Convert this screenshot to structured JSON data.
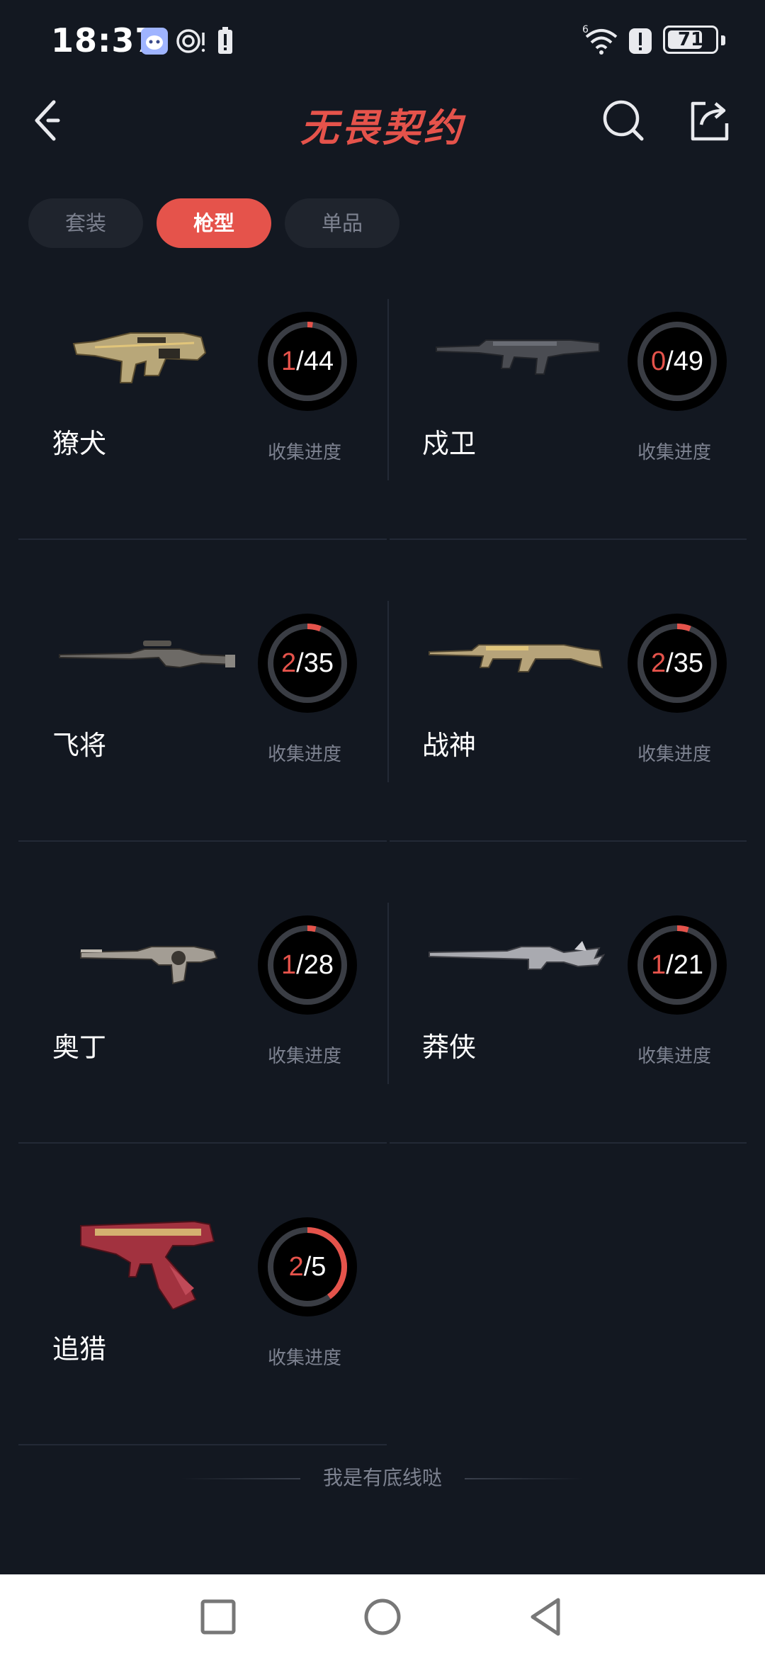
{
  "status_bar": {
    "time": "18:37",
    "battery": "71",
    "icons": [
      "app-notification-icon",
      "nfc-icon",
      "battery-alert-icon",
      "wifi-icon",
      "alert-icon"
    ]
  },
  "header": {
    "title": "无畏契约",
    "back_icon": "back-arrow-icon",
    "search_icon": "search-icon",
    "share_icon": "share-icon"
  },
  "tabs": [
    {
      "label": "套装",
      "active": false
    },
    {
      "label": "枪型",
      "active": true
    },
    {
      "label": "单品",
      "active": false
    }
  ],
  "weapons": [
    {
      "name": "獠犬",
      "collected": 1,
      "total": 44,
      "progress_text_num": "1",
      "progress_text_den": "/44",
      "progress_label": "收集进度"
    },
    {
      "name": "戍卫",
      "collected": 0,
      "total": 49,
      "progress_text_num": "0",
      "progress_text_den": "/49",
      "progress_label": "收集进度"
    },
    {
      "name": "飞将",
      "collected": 2,
      "total": 35,
      "progress_text_num": "2",
      "progress_text_den": "/35",
      "progress_label": "收集进度"
    },
    {
      "name": "战神",
      "collected": 2,
      "total": 35,
      "progress_text_num": "2",
      "progress_text_den": "/35",
      "progress_label": "收集进度"
    },
    {
      "name": "奥丁",
      "collected": 1,
      "total": 28,
      "progress_text_num": "1",
      "progress_text_den": "/28",
      "progress_label": "收集进度"
    },
    {
      "name": "莽侠",
      "collected": 1,
      "total": 21,
      "progress_text_num": "1",
      "progress_text_den": "/21",
      "progress_label": "收集进度"
    },
    {
      "name": "追猎",
      "collected": 2,
      "total": 5,
      "progress_text_num": "2",
      "progress_text_den": "/5",
      "progress_label": "收集进度"
    }
  ],
  "footer": {
    "text": "我是有底线哒"
  },
  "colors": {
    "background": "#131821",
    "accent": "#e5534b",
    "muted": "#7d8290"
  }
}
